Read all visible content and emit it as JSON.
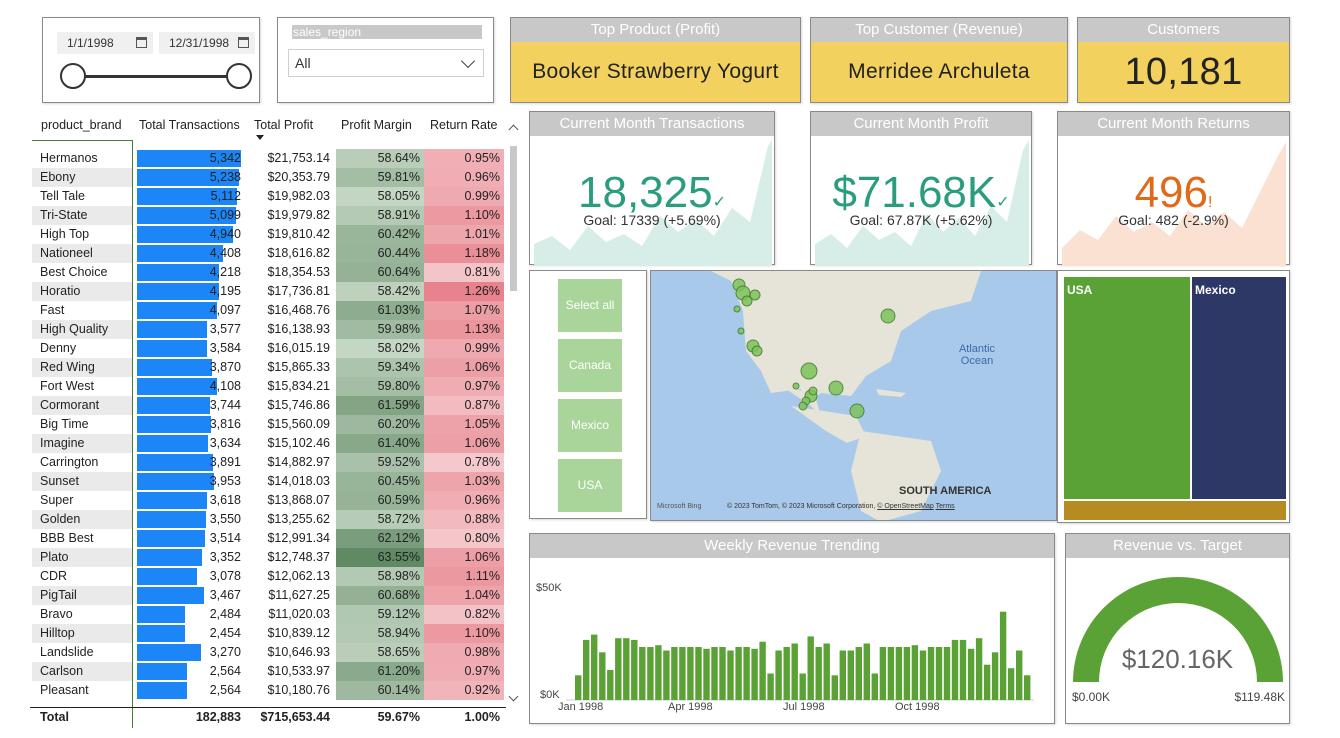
{
  "date_slicer": {
    "start": "1/1/1998",
    "end": "12/31/1998"
  },
  "region_slicer": {
    "title": "sales_region",
    "value": "All"
  },
  "kpis": {
    "top_product": {
      "label": "Top Product (Profit)",
      "value": "Booker Strawberry Yogurt"
    },
    "top_customer": {
      "label": "Top Customer (Revenue)",
      "value": "Merridee Archuleta"
    },
    "customers": {
      "label": "Customers",
      "value": "10,181"
    }
  },
  "table": {
    "headers": [
      "product_brand",
      "Total Transactions",
      "Total Profit",
      "Profit Margin",
      "Return Rate"
    ],
    "rows": [
      [
        "Hermanos",
        "5,342",
        "$21,753.14",
        "58.64%",
        "0.95%"
      ],
      [
        "Ebony",
        "5,238",
        "$20,353.79",
        "59.81%",
        "0.96%"
      ],
      [
        "Tell Tale",
        "5,112",
        "$19,982.03",
        "58.05%",
        "0.99%"
      ],
      [
        "Tri-State",
        "5,099",
        "$19,979.82",
        "58.91%",
        "1.10%"
      ],
      [
        "High Top",
        "4,940",
        "$19,810.42",
        "60.42%",
        "1.01%"
      ],
      [
        "Nationeel",
        "4,408",
        "$18,616.82",
        "60.44%",
        "1.18%"
      ],
      [
        "Best Choice",
        "4,218",
        "$18,354.53",
        "60.64%",
        "0.81%"
      ],
      [
        "Horatio",
        "4,195",
        "$17,736.81",
        "58.42%",
        "1.26%"
      ],
      [
        "Fast",
        "4,097",
        "$16,468.76",
        "61.03%",
        "1.07%"
      ],
      [
        "High Quality",
        "3,577",
        "$16,138.93",
        "59.98%",
        "1.13%"
      ],
      [
        "Denny",
        "3,584",
        "$16,015.19",
        "58.02%",
        "0.99%"
      ],
      [
        "Red Wing",
        "3,870",
        "$15,865.33",
        "59.34%",
        "1.06%"
      ],
      [
        "Fort West",
        "4,108",
        "$15,834.21",
        "59.80%",
        "0.97%"
      ],
      [
        "Cormorant",
        "3,744",
        "$15,746.86",
        "61.59%",
        "0.87%"
      ],
      [
        "Big Time",
        "3,816",
        "$15,560.09",
        "60.20%",
        "1.05%"
      ],
      [
        "Imagine",
        "3,634",
        "$15,102.46",
        "61.40%",
        "1.06%"
      ],
      [
        "Carrington",
        "3,891",
        "$14,882.97",
        "59.52%",
        "0.78%"
      ],
      [
        "Sunset",
        "3,953",
        "$14,018.03",
        "60.45%",
        "1.03%"
      ],
      [
        "Super",
        "3,618",
        "$13,868.07",
        "60.59%",
        "0.96%"
      ],
      [
        "Golden",
        "3,550",
        "$13,255.62",
        "58.72%",
        "0.88%"
      ],
      [
        "BBB Best",
        "3,514",
        "$12,991.34",
        "62.12%",
        "0.80%"
      ],
      [
        "Plato",
        "3,352",
        "$12,748.37",
        "63.55%",
        "1.06%"
      ],
      [
        "CDR",
        "3,078",
        "$12,062.13",
        "58.98%",
        "1.11%"
      ],
      [
        "PigTail",
        "3,467",
        "$11,627.25",
        "60.68%",
        "1.04%"
      ],
      [
        "Bravo",
        "2,484",
        "$11,020.03",
        "59.12%",
        "0.82%"
      ],
      [
        "Hilltop",
        "2,454",
        "$10,839.12",
        "58.94%",
        "1.10%"
      ],
      [
        "Landslide",
        "3,270",
        "$10,646.93",
        "58.65%",
        "0.98%"
      ],
      [
        "Carlson",
        "2,564",
        "$10,533.97",
        "61.20%",
        "0.97%"
      ],
      [
        "Pleasant",
        "2,564",
        "$10,180.76",
        "60.14%",
        "0.92%"
      ]
    ],
    "tx_values": [
      5342,
      5238,
      5112,
      5099,
      4940,
      4408,
      4218,
      4195,
      4097,
      3577,
      3584,
      3870,
      4108,
      3744,
      3816,
      3634,
      3891,
      3953,
      3618,
      3550,
      3514,
      3352,
      3078,
      3467,
      2484,
      2454,
      3270,
      2564,
      2564
    ],
    "totals": [
      "Total",
      "182,883",
      "$715,653.44",
      "59.67%",
      "1.00%"
    ]
  },
  "month_cards": {
    "transactions": {
      "label": "Current Month Transactions",
      "value": "18,325",
      "goal": "Goal: 17339 (+5.69%)",
      "status": "✓"
    },
    "profit": {
      "label": "Current Month Profit",
      "value": "$71.68K",
      "goal": "Goal: 67.87K (+5.62%)",
      "status": "✓"
    },
    "returns": {
      "label": "Current Month Returns",
      "value": "496",
      "goal": "Goal: 482 (-2.9%)",
      "status": "!"
    }
  },
  "country_slicer": {
    "items": [
      "Select all",
      "Canada",
      "Mexico",
      "USA"
    ]
  },
  "map": {
    "ocean_label": "Atlantic\nOcean",
    "continent_label": "SOUTH AMERICA",
    "credits": "© 2023 TomTom, © 2023 Microsoft Corporation,",
    "osm_link": "© OpenStreetMap",
    "terms_link": "Terms",
    "bing_logo": "Microsoft Bing"
  },
  "treemap": {
    "items": [
      {
        "label": "USA"
      },
      {
        "label": "Mexico"
      }
    ]
  },
  "weekly_chart": {
    "title": "Weekly Revenue Trending",
    "y_ticks": [
      "$50K",
      "$0K"
    ],
    "x_ticks": [
      "Jan 1998",
      "Apr 1998",
      "Jul 1998",
      "Oct 1998"
    ]
  },
  "chart_data": {
    "type": "bar",
    "title": "Weekly Revenue Trending",
    "xlabel": "",
    "ylabel": "",
    "ylim": [
      0,
      60
    ],
    "x_ticks": [
      "Jan 1998",
      "Apr 1998",
      "Jul 1998",
      "Oct 1998"
    ],
    "values": [
      14,
      34,
      37,
      27,
      17,
      35,
      35,
      34,
      30,
      30,
      31,
      28,
      30,
      30,
      30,
      30,
      29,
      30,
      30,
      28,
      30,
      30,
      29,
      33,
      15,
      28,
      30,
      32,
      15,
      36,
      30,
      32,
      14,
      28,
      28,
      30,
      32,
      15,
      30,
      30,
      30,
      30,
      31,
      28,
      30,
      30,
      30,
      34,
      34,
      29,
      35,
      20,
      27,
      50,
      18,
      28,
      14
    ]
  },
  "gauge": {
    "title": "Revenue vs. Target",
    "value": "$120.16K",
    "min": "$0.00K",
    "max": "$119.48K",
    "fill_fraction": 1.0
  }
}
